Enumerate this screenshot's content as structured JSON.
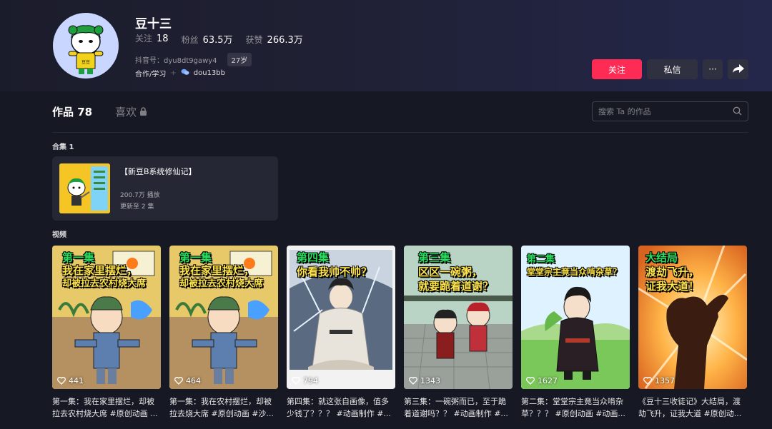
{
  "profile": {
    "name": "豆十三",
    "stats": [
      {
        "label": "关注",
        "value": "18"
      },
      {
        "label": "粉丝",
        "value": "63.5万"
      },
      {
        "label": "获赞",
        "value": "266.3万"
      }
    ],
    "douyin_id": "抖音号：dyu8dt9gawy4",
    "age": "27岁",
    "category": "合作/学习",
    "contact": "dou13bb",
    "avatar_badge": "豆豆"
  },
  "actions": {
    "follow": "关注",
    "message": "私信",
    "more": "···"
  },
  "tabs": {
    "works": "作品 78",
    "likes": "喜欢"
  },
  "search": {
    "placeholder": "搜索 Ta 的作品"
  },
  "collections": {
    "title": "合集 1",
    "items": [
      {
        "title": "【新豆B系统修仙记】",
        "plays": "200.7万 播放",
        "update": "更新至 2 集"
      }
    ]
  },
  "videos_title": "视频",
  "videos": [
    {
      "likes": "441",
      "caption": "第一集：我在家里摆烂，却被拉去农村烧大席 #原创动画 ...",
      "overlay": [
        "第一集",
        "我在家里摆烂，",
        "却被拉去农村烧大席"
      ]
    },
    {
      "likes": "464",
      "caption": "第一集：我在农村摆烂，却被拉去烧大席 #原创动画 #沙...",
      "overlay": [
        "第一集",
        "我在家里摆烂，",
        "却被拉去农村烧大席"
      ]
    },
    {
      "likes": "794",
      "caption": "第四集：就这张自画像，值多少钱了？？？ #动画制作 #...",
      "overlay": [
        "第四集",
        "你看我帅不帅？"
      ]
    },
    {
      "likes": "1343",
      "caption": "第三集：一碗粥而已，至于跪着道谢吗？？ #动画制作 #...",
      "overlay": [
        "第三集",
        "区区一碗粥，",
        "就要跪着道谢？"
      ]
    },
    {
      "likes": "1627",
      "caption": "第二集：堂堂宗主竟当众啃杂草？？？ #原创动画 #动画...",
      "overlay": [
        "第二集",
        "堂堂宗主竟当众啃杂草？"
      ]
    },
    {
      "likes": "1357",
      "caption": "《豆十三收徒记》大结局，渡劫飞升，证我大道 #原创动...",
      "overlay": [
        "大结局",
        "渡劫飞升，",
        "证我大道！"
      ]
    }
  ],
  "colors": {
    "background": "#161823",
    "accent": "#fe2c55",
    "button_dark": "#2f3040"
  }
}
